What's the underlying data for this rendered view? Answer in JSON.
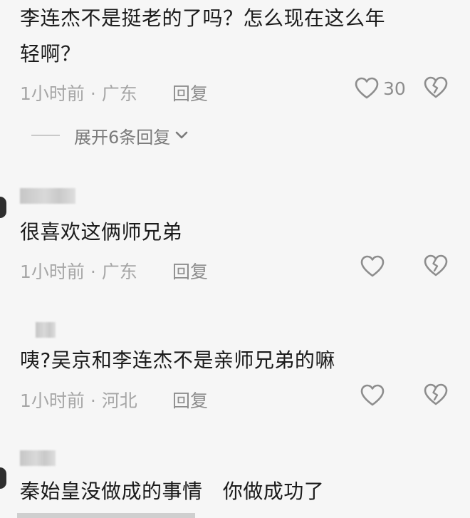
{
  "comments": [
    {
      "text_line1": "李连杰不是挺老的了吗？怎么现在这么年",
      "text_line2": "轻啊？",
      "time_location": "1小时前 · 广东",
      "reply_label": "回复",
      "like_count": "30",
      "expand_replies_label": "展开6条回复"
    },
    {
      "text": "很喜欢这俩师兄弟",
      "time_location": "1小时前 · 广东",
      "reply_label": "回复",
      "like_count": ""
    },
    {
      "text": "咦?吴京和李连杰不是亲师兄弟的嘛",
      "time_location": "1小时前 · 河北",
      "reply_label": "回复",
      "like_count": ""
    },
    {
      "text": "秦始皇没做成的事情   你做成功了"
    }
  ],
  "icons": {
    "like": "heart-outline-icon",
    "dislike": "broken-heart-icon",
    "expand": "chevron-down-icon"
  },
  "colors": {
    "background": "#f6f6f6",
    "text_primary": "#1b1b1b",
    "text_meta": "#a6a6a6",
    "text_action": "#8d8d8d"
  }
}
